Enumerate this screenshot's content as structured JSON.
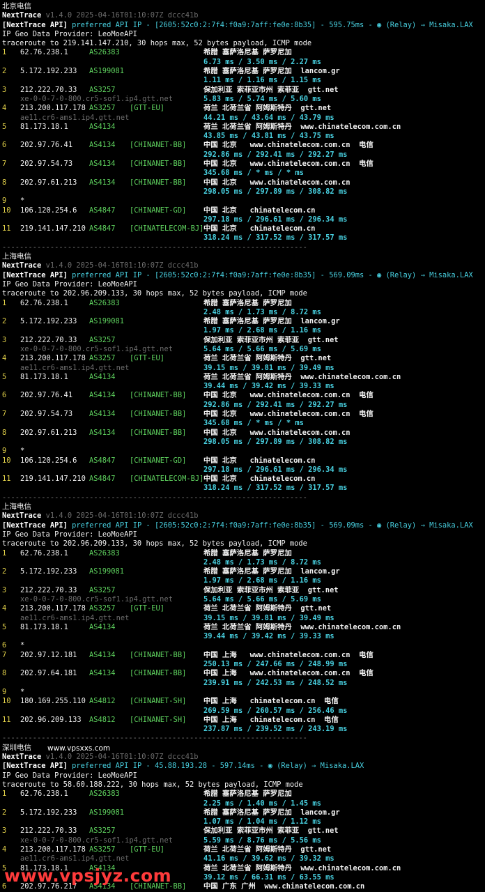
{
  "sections": [
    {
      "title": "北京电信",
      "tool_line": "v1.4.0 2025-04-16T01:10:07Z dccc41b",
      "api_line": "preferred API IP - [2605:52c0:2:7f4:f0a9:7aff:fe0e:8b35] - 595.75ms - ◉ (Relay) → Misaka.LAX",
      "provider": "IP Geo Data Provider: LeoMoeAPI",
      "traceroute": "traceroute to 219.141.147.210, 30 hops max, 52 bytes payload, ICMP mode",
      "hops": [
        {
          "n": "1",
          "ip": "62.76.238.1",
          "as": "AS26383",
          "tag": "",
          "geo": "希腊 塞萨洛尼基 萨罗尼加",
          "ptr": "",
          "lat": "6.73 ms / 3.50 ms / 2.27 ms"
        },
        {
          "n": "2",
          "ip": "5.172.192.233",
          "as": "AS199081",
          "tag": "",
          "geo": "希腊 塞萨洛尼基 萨罗尼加  lancom.gr",
          "ptr": "",
          "lat": "1.11 ms / 1.16 ms / 1.15 ms"
        },
        {
          "n": "3",
          "ip": "212.222.70.33",
          "as": "AS3257",
          "tag": "",
          "geo": "保加利亚 索菲亚市州 索菲亚  gtt.net",
          "ptr": "xe-0-0-7-0-800.cr5-sof1.ip4.gtt.net",
          "lat": "5.83 ms / 5.74 ms / 5.60 ms"
        },
        {
          "n": "4",
          "ip": "213.200.117.178",
          "as": "AS3257",
          "tag": "[GTT-EU]",
          "geo": "荷兰 北荷兰省 阿姆斯特丹  gtt.net",
          "ptr": "ae11.cr6-ams1.ip4.gtt.net",
          "lat": "44.21 ms / 43.64 ms / 43.79 ms"
        },
        {
          "n": "5",
          "ip": "81.173.18.1",
          "as": "AS4134",
          "tag": "",
          "geo": "荷兰 北荷兰省 阿姆斯特丹  www.chinatelecom.com.cn",
          "ptr": "",
          "lat": "43.85 ms / 43.81 ms / 43.75 ms"
        },
        {
          "n": "6",
          "ip": "202.97.76.41",
          "as": "AS4134",
          "tag": "[CHINANET-BB]",
          "geo": "中国 北京   www.chinatelecom.com.cn  电信",
          "ptr": "",
          "lat": "292.86 ms / 292.41 ms / 292.27 ms"
        },
        {
          "n": "7",
          "ip": "202.97.54.73",
          "as": "AS4134",
          "tag": "[CHINANET-BB]",
          "geo": "中国 北京   www.chinatelecom.com.cn  电信",
          "ptr": "",
          "lat": "345.68 ms / * ms / * ms"
        },
        {
          "n": "8",
          "ip": "202.97.61.213",
          "as": "AS4134",
          "tag": "[CHINANET-BB]",
          "geo": "中国 北京   www.chinatelecom.com.cn",
          "ptr": "",
          "lat": "298.05 ms / 297.89 ms / 308.82 ms"
        },
        {
          "n": "9",
          "ip": "*",
          "as": "",
          "tag": "",
          "geo": "",
          "ptr": "",
          "lat": ""
        },
        {
          "n": "10",
          "ip": "106.120.254.6",
          "as": "AS4847",
          "tag": "[CHINANET-GD]",
          "geo": "中国 北京   chinatelecom.cn",
          "ptr": "",
          "lat": "297.18 ms / 296.61 ms / 296.34 ms"
        },
        {
          "n": "11",
          "ip": "219.141.147.210",
          "as": "AS4847",
          "tag": "[CHINATELECOM-BJ]",
          "geo": "中国 北京   chinatelecom.cn",
          "ptr": "",
          "lat": "318.24 ms / 317.52 ms / 317.57 ms"
        }
      ]
    },
    {
      "title": "上海电信",
      "tool_line": "v1.4.0 2025-04-16T01:10:07Z dccc41b",
      "api_line": "preferred API IP - [2605:52c0:2:7f4:f0a9:7aff:fe0e:8b35] - 569.09ms - ◉ (Relay) → Misaka.LAX",
      "provider": "IP Geo Data Provider: LeoMoeAPI",
      "traceroute": "traceroute to 202.96.209.133, 30 hops max, 52 bytes payload, ICMP mode",
      "hops": [
        {
          "n": "1",
          "ip": "62.76.238.1",
          "as": "AS26383",
          "tag": "",
          "geo": "希腊 塞萨洛尼基 萨罗尼加",
          "ptr": "",
          "lat": "2.48 ms / 1.73 ms / 8.72 ms"
        },
        {
          "n": "2",
          "ip": "5.172.192.233",
          "as": "AS199081",
          "tag": "",
          "geo": "希腊 塞萨洛尼基 萨罗尼加  lancom.gr",
          "ptr": "",
          "lat": "1.97 ms / 2.68 ms / 1.16 ms"
        },
        {
          "n": "3",
          "ip": "212.222.70.33",
          "as": "AS3257",
          "tag": "",
          "geo": "保加利亚 索菲亚市州 索菲亚  gtt.net",
          "ptr": "xe-0-0-7-0-800.cr5-sof1.ip4.gtt.net",
          "lat": "5.64 ms / 5.66 ms / 5.69 ms"
        },
        {
          "n": "4",
          "ip": "213.200.117.178",
          "as": "AS3257",
          "tag": "[GTT-EU]",
          "geo": "荷兰 北荷兰省 阿姆斯特丹  gtt.net",
          "ptr": "ae11.cr6-ams1.ip4.gtt.net",
          "lat": "39.15 ms / 39.81 ms / 39.49 ms"
        },
        {
          "n": "5",
          "ip": "81.173.18.1",
          "as": "AS4134",
          "tag": "",
          "geo": "荷兰 北荷兰省 阿姆斯特丹  www.chinatelecom.com.cn",
          "ptr": "",
          "lat": "39.44 ms / 39.42 ms / 39.33 ms"
        },
        {
          "n": "6",
          "ip": "202.97.76.41",
          "as": "AS4134",
          "tag": "[CHINANET-BB]",
          "geo": "中国 北京   www.chinatelecom.com.cn  电信",
          "ptr": "",
          "lat": "292.86 ms / 292.41 ms / 292.27 ms"
        },
        {
          "n": "7",
          "ip": "202.97.54.73",
          "as": "AS4134",
          "tag": "[CHINANET-BB]",
          "geo": "中国 北京   www.chinatelecom.com.cn  电信",
          "ptr": "",
          "lat": "345.68 ms / * ms / * ms"
        },
        {
          "n": "8",
          "ip": "202.97.61.213",
          "as": "AS4134",
          "tag": "[CHINANET-BB]",
          "geo": "中国 北京   www.chinatelecom.com.cn",
          "ptr": "",
          "lat": "298.05 ms / 297.89 ms / 308.82 ms"
        },
        {
          "n": "9",
          "ip": "*",
          "as": "",
          "tag": "",
          "geo": "",
          "ptr": "",
          "lat": ""
        },
        {
          "n": "10",
          "ip": "106.120.254.6",
          "as": "AS4847",
          "tag": "[CHINANET-GD]",
          "geo": "中国 北京   chinatelecom.cn",
          "ptr": "",
          "lat": "297.18 ms / 296.61 ms / 296.34 ms"
        },
        {
          "n": "11",
          "ip": "219.141.147.210",
          "as": "AS4847",
          "tag": "[CHINATELECOM-BJ]",
          "geo": "中国 北京   chinatelecom.cn",
          "ptr": "",
          "lat": "318.24 ms / 317.52 ms / 317.57 ms"
        }
      ]
    },
    {
      "title": "上海电信",
      "tool_line": "v1.4.0 2025-04-16T01:10:07Z dccc41b",
      "api_line": "preferred API IP - [2605:52c0:2:7f4:f0a9:7aff:fe0e:8b35] - 569.09ms - ◉ (Relay) → Misaka.LAX",
      "provider": "IP Geo Data Provider: LeoMoeAPI",
      "traceroute": "traceroute to 202.96.209.133, 30 hops max, 52 bytes payload, ICMP mode",
      "hops": [
        {
          "n": "1",
          "ip": "62.76.238.1",
          "as": "AS26383",
          "tag": "",
          "geo": "希腊 塞萨洛尼基 萨罗尼加",
          "ptr": "",
          "lat": "2.48 ms / 1.73 ms / 8.72 ms"
        },
        {
          "n": "2",
          "ip": "5.172.192.233",
          "as": "AS199081",
          "tag": "",
          "geo": "希腊 塞萨洛尼基 萨罗尼加  lancom.gr",
          "ptr": "",
          "lat": "1.97 ms / 2.68 ms / 1.16 ms"
        },
        {
          "n": "3",
          "ip": "212.222.70.33",
          "as": "AS3257",
          "tag": "",
          "geo": "保加利亚 索菲亚市州 索菲亚  gtt.net",
          "ptr": "xe-0-0-7-0-800.cr5-sof1.ip4.gtt.net",
          "lat": "5.64 ms / 5.66 ms / 5.69 ms"
        },
        {
          "n": "4",
          "ip": "213.200.117.178",
          "as": "AS3257",
          "tag": "[GTT-EU]",
          "geo": "荷兰 北荷兰省 阿姆斯特丹  gtt.net",
          "ptr": "ae11.cr6-ams1.ip4.gtt.net",
          "lat": "39.15 ms / 39.81 ms / 39.49 ms"
        },
        {
          "n": "5",
          "ip": "81.173.18.1",
          "as": "AS4134",
          "tag": "",
          "geo": "荷兰 北荷兰省 阿姆斯特丹  www.chinatelecom.com.cn",
          "ptr": "",
          "lat": "39.44 ms / 39.42 ms / 39.33 ms"
        },
        {
          "n": "6",
          "ip": "*",
          "as": "",
          "tag": "",
          "geo": "",
          "ptr": "",
          "lat": ""
        },
        {
          "n": "7",
          "ip": "202.97.12.181",
          "as": "AS4134",
          "tag": "[CHINANET-BB]",
          "geo": "中国 上海   www.chinatelecom.com.cn  电信",
          "ptr": "",
          "lat": "250.13 ms / 247.66 ms / 248.99 ms"
        },
        {
          "n": "8",
          "ip": "202.97.64.181",
          "as": "AS4134",
          "tag": "[CHINANET-BB]",
          "geo": "中国 上海   www.chinatelecom.com.cn  电信",
          "ptr": "",
          "lat": "239.91 ms / 242.53 ms / 248.52 ms"
        },
        {
          "n": "9",
          "ip": "*",
          "as": "",
          "tag": "",
          "geo": "",
          "ptr": "",
          "lat": ""
        },
        {
          "n": "10",
          "ip": "180.169.255.110",
          "as": "AS4812",
          "tag": "[CHINANET-SH]",
          "geo": "中国 上海   chinatelecom.cn  电信",
          "ptr": "",
          "lat": "269.59 ms / 260.57 ms / 256.46 ms"
        },
        {
          "n": "11",
          "ip": "202.96.209.133",
          "as": "AS4812",
          "tag": "[CHINANET-SH]",
          "geo": "中国 上海   chinatelecom.cn  电信",
          "ptr": "",
          "lat": "237.87 ms / 239.52 ms / 243.19 ms"
        }
      ]
    },
    {
      "title": "深圳电信",
      "tool_line": "v1.4.0 2025-04-16T01:10:07Z dccc41b",
      "api_line": "preferred API IP - 45.88.193.28 - 597.14ms - ◉ (Relay) → Misaka.LAX",
      "provider": "IP Geo Data Provider: LeoMoeAPI",
      "traceroute": "traceroute to 58.60.188.222, 30 hops max, 52 bytes payload, ICMP mode",
      "hops": [
        {
          "n": "1",
          "ip": "62.76.238.1",
          "as": "AS26383",
          "tag": "",
          "geo": "希腊 塞萨洛尼基 萨罗尼加",
          "ptr": "",
          "lat": "2.25 ms / 1.40 ms / 1.45 ms"
        },
        {
          "n": "2",
          "ip": "5.172.192.233",
          "as": "AS199081",
          "tag": "",
          "geo": "希腊 塞萨洛尼基 萨罗尼加  lancom.gr",
          "ptr": "",
          "lat": "1.07 ms / 1.04 ms / 1.12 ms"
        },
        {
          "n": "3",
          "ip": "212.222.70.33",
          "as": "AS3257",
          "tag": "",
          "geo": "保加利亚 索菲亚市州 索菲亚  gtt.net",
          "ptr": "xe-0-0-7-0-800.cr5-sof1.ip4.gtt.net",
          "lat": "5.59 ms / 8.76 ms / 5.56 ms"
        },
        {
          "n": "4",
          "ip": "213.200.117.178",
          "as": "AS3257",
          "tag": "[GTT-EU]",
          "geo": "荷兰 北荷兰省 阿姆斯特丹  gtt.net",
          "ptr": "ae11.cr6-ams1.ip4.gtt.net",
          "lat": "41.16 ms / 39.62 ms / 39.32 ms"
        },
        {
          "n": "5",
          "ip": "81.173.18.1",
          "as": "AS4134",
          "tag": "",
          "geo": "荷兰 北荷兰省 阿姆斯特丹  www.chinatelecom.com.cn",
          "ptr": "",
          "lat": "39.12 ms / 66.31 ms / 63.55 ms"
        },
        {
          "n": "6",
          "ip": "202.97.76.217",
          "as": "AS4134",
          "tag": "[CHINANET-BB]",
          "geo": "中国 广东 广州  www.chinatelecom.com.cn",
          "ptr": "",
          "lat": ""
        }
      ]
    }
  ],
  "nexttrace_label": "NextTrace",
  "api_label": "[NextTrace API]",
  "separator": "----------------------------------------------------------------------",
  "site_label": "www.vpsxxs.com",
  "watermark": "www.vpsjyz.com"
}
